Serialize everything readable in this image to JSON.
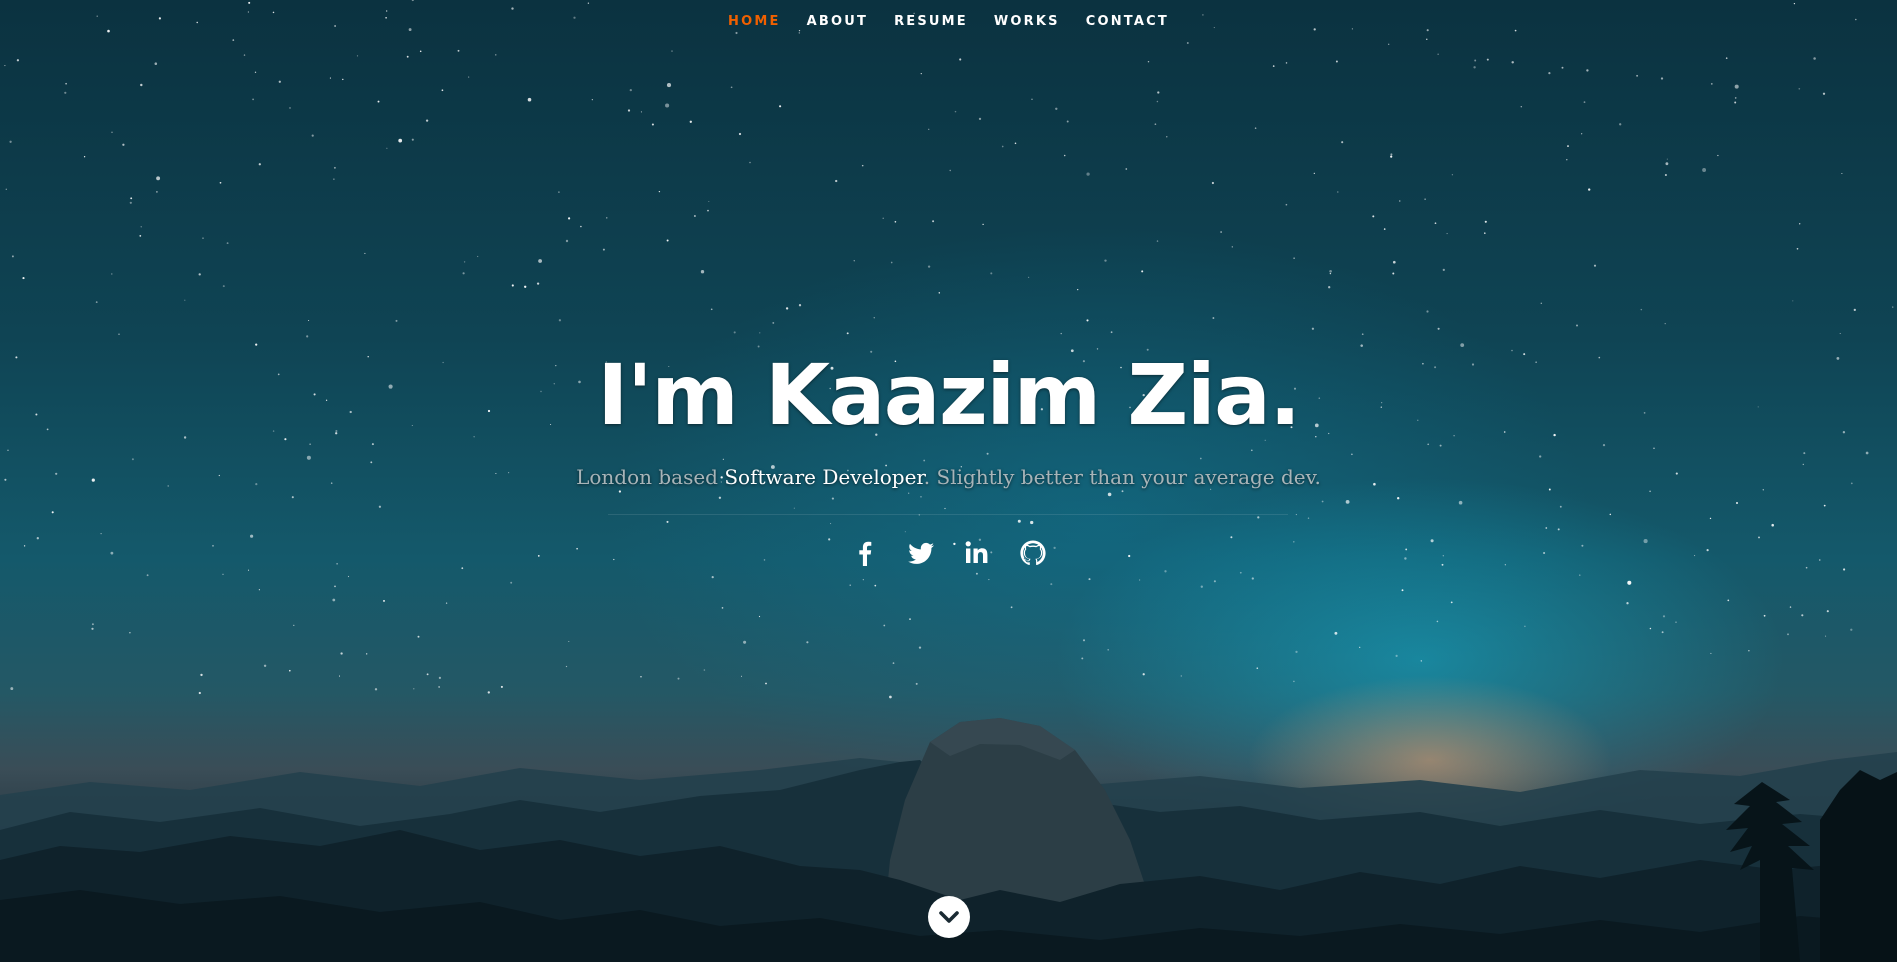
{
  "nav": {
    "items": [
      {
        "label": "HOME",
        "active": true
      },
      {
        "label": "ABOUT",
        "active": false
      },
      {
        "label": "RESUME",
        "active": false
      },
      {
        "label": "WORKS",
        "active": false
      },
      {
        "label": "CONTACT",
        "active": false
      }
    ],
    "active_color": "#f06000"
  },
  "hero": {
    "headline": "I'm Kaazim Zia.",
    "tagline": {
      "prefix": "London based ",
      "highlight": "Software Developer",
      "suffix": ". Slightly better than your average dev."
    }
  },
  "social": [
    {
      "icon": "facebook-icon"
    },
    {
      "icon": "twitter-icon"
    },
    {
      "icon": "linkedin-icon"
    },
    {
      "icon": "github-icon"
    }
  ],
  "scroll": {
    "icon": "chevron-down-icon"
  },
  "colors": {
    "text": "#ffffff",
    "muted": "#a8b4b8"
  }
}
